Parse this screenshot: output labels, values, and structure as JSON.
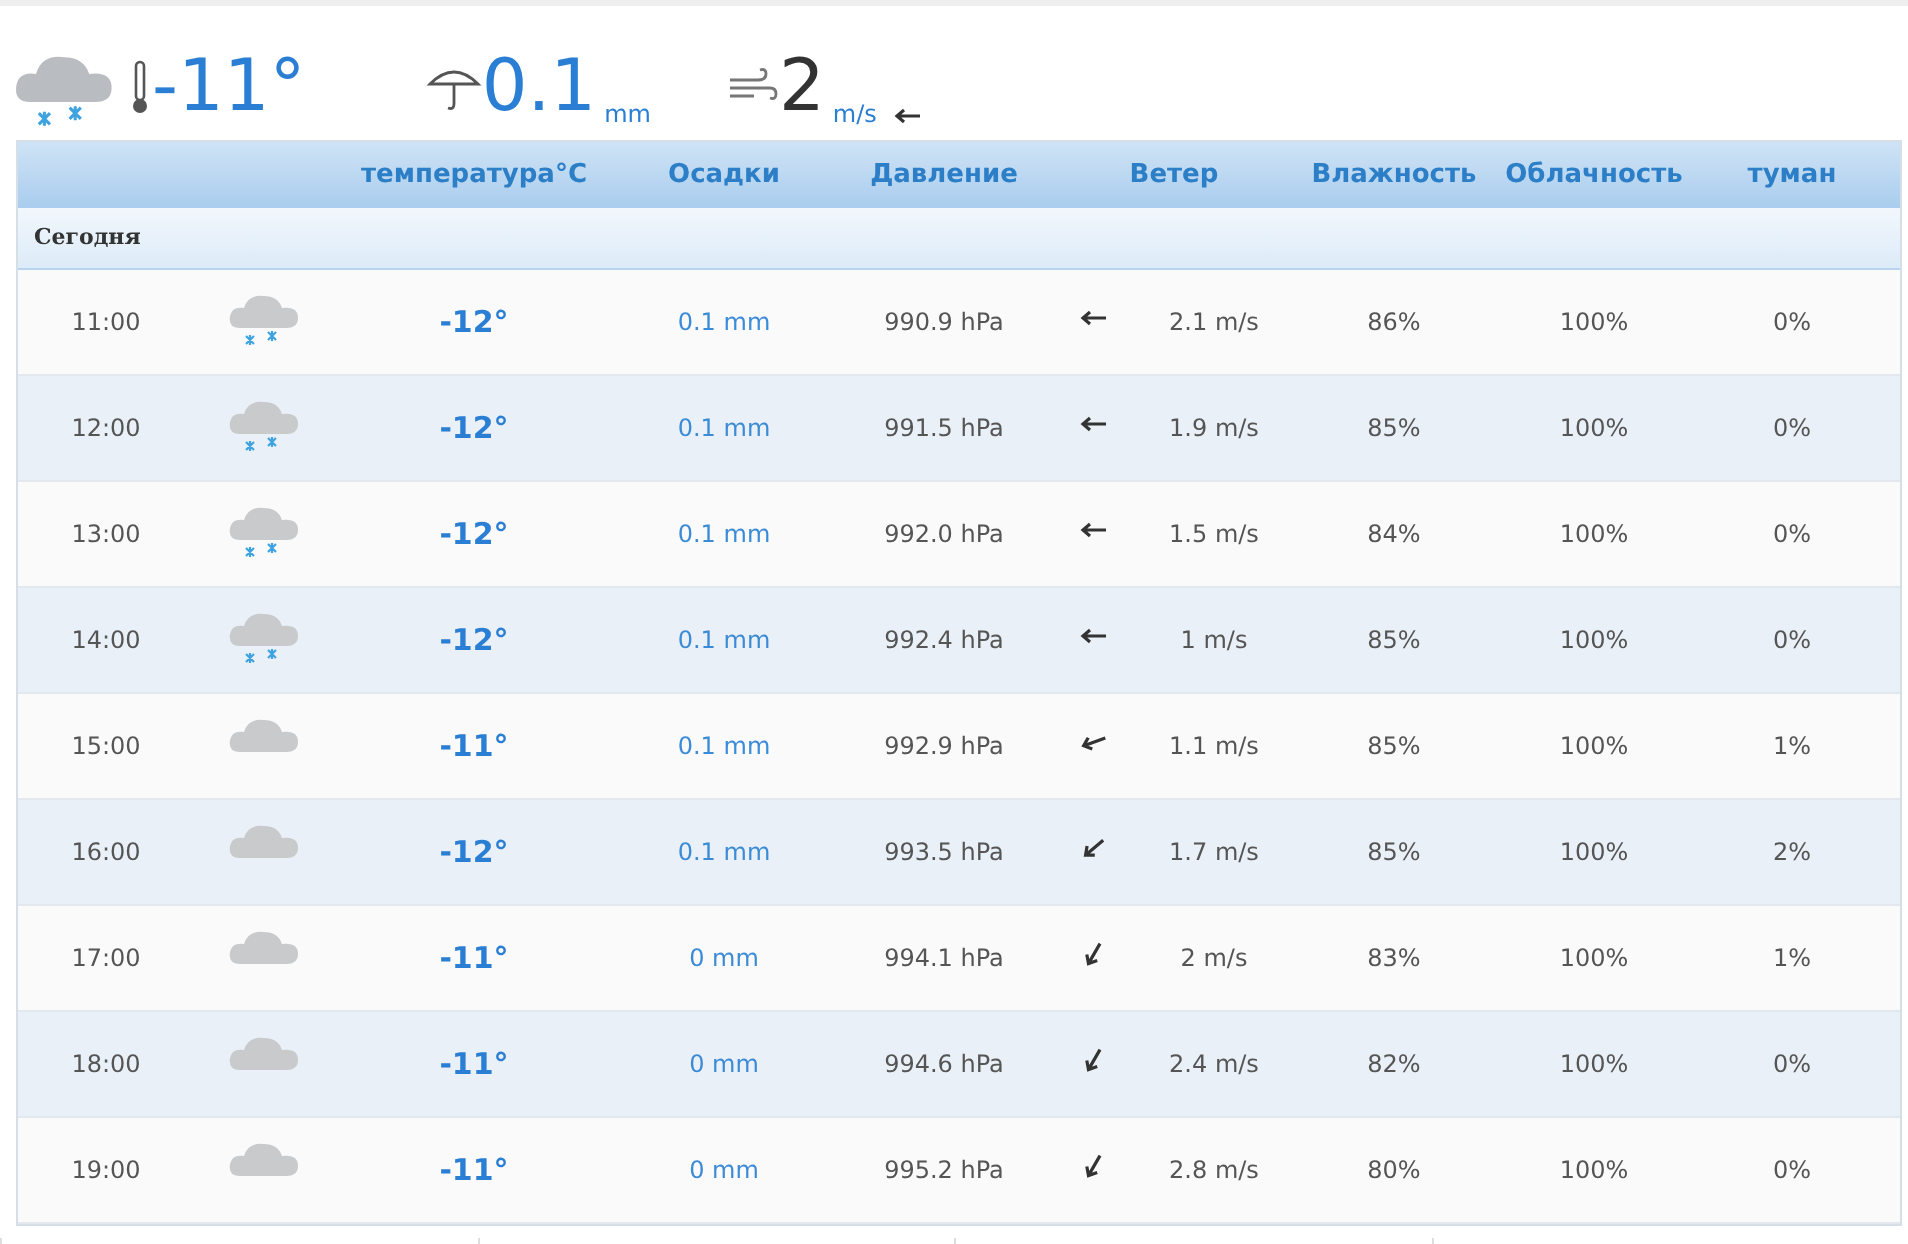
{
  "current": {
    "weather_icon": {
      "kind": "snow"
    },
    "temperature": "-11°",
    "precipitation": "0.1",
    "precipitation_unit": "mm",
    "wind": "2",
    "wind_unit": "m/s",
    "wind_icon": {
      "kind": "E"
    }
  },
  "table": {
    "columns": [
      "температура°C",
      "Осадки",
      "Давление",
      "Ветер",
      "Влажность",
      "Облачность",
      "туман"
    ],
    "section": "Сегодня",
    "rows": [
      {
        "time": "11:00",
        "weather_icon": {
          "kind": "snow"
        },
        "temperature": "-12°",
        "precipitation": "0.1 mm",
        "pressure": "990.9 hPa",
        "wind_icon": {
          "kind": "E"
        },
        "wind": "2.1 m/s",
        "humidity": "86%",
        "cloudiness": "100%",
        "fog": "0%"
      },
      {
        "time": "12:00",
        "weather_icon": {
          "kind": "snow"
        },
        "temperature": "-12°",
        "precipitation": "0.1 mm",
        "pressure": "991.5 hPa",
        "wind_icon": {
          "kind": "E"
        },
        "wind": "1.9 m/s",
        "humidity": "85%",
        "cloudiness": "100%",
        "fog": "0%"
      },
      {
        "time": "13:00",
        "weather_icon": {
          "kind": "snow"
        },
        "temperature": "-12°",
        "precipitation": "0.1 mm",
        "pressure": "992.0 hPa",
        "wind_icon": {
          "kind": "E"
        },
        "wind": "1.5 m/s",
        "humidity": "84%",
        "cloudiness": "100%",
        "fog": "0%"
      },
      {
        "time": "14:00",
        "weather_icon": {
          "kind": "snow"
        },
        "temperature": "-12°",
        "precipitation": "0.1 mm",
        "pressure": "992.4 hPa",
        "wind_icon": {
          "kind": "E"
        },
        "wind": "1 m/s",
        "humidity": "85%",
        "cloudiness": "100%",
        "fog": "0%"
      },
      {
        "time": "15:00",
        "weather_icon": {
          "kind": "cloudy"
        },
        "temperature": "-11°",
        "precipitation": "0.1 mm",
        "pressure": "992.9 hPa",
        "wind_icon": {
          "kind": "ENE"
        },
        "wind": "1.1 m/s",
        "humidity": "85%",
        "cloudiness": "100%",
        "fog": "1%"
      },
      {
        "time": "16:00",
        "weather_icon": {
          "kind": "cloudy"
        },
        "temperature": "-12°",
        "precipitation": "0.1 mm",
        "pressure": "993.5 hPa",
        "wind_icon": {
          "kind": "NE"
        },
        "wind": "1.7 m/s",
        "humidity": "85%",
        "cloudiness": "100%",
        "fog": "2%"
      },
      {
        "time": "17:00",
        "weather_icon": {
          "kind": "cloudy"
        },
        "temperature": "-11°",
        "precipitation": "0 mm",
        "pressure": "994.1 hPa",
        "wind_icon": {
          "kind": "NNE"
        },
        "wind": "2 m/s",
        "humidity": "83%",
        "cloudiness": "100%",
        "fog": "1%"
      },
      {
        "time": "18:00",
        "weather_icon": {
          "kind": "cloudy"
        },
        "temperature": "-11°",
        "precipitation": "0 mm",
        "pressure": "994.6 hPa",
        "wind_icon": {
          "kind": "NNE"
        },
        "wind": "2.4 m/s",
        "humidity": "82%",
        "cloudiness": "100%",
        "fog": "0%"
      },
      {
        "time": "19:00",
        "weather_icon": {
          "kind": "cloudy"
        },
        "temperature": "-11°",
        "precipitation": "0 mm",
        "pressure": "995.2 hPa",
        "wind_icon": {
          "kind": "NNE"
        },
        "wind": "2.8 m/s",
        "humidity": "80%",
        "cloudiness": "100%",
        "fog": "0%"
      }
    ]
  }
}
